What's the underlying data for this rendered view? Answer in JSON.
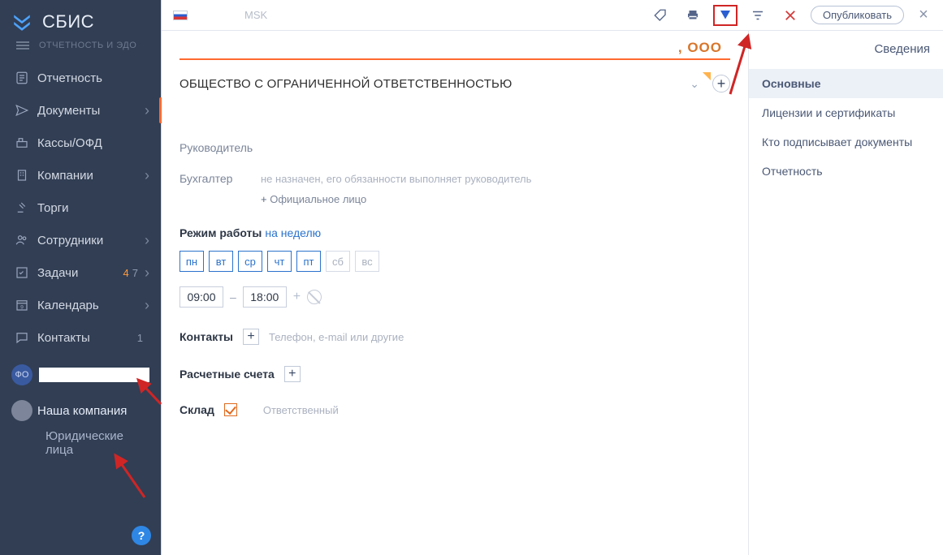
{
  "brand": {
    "title": "СБИС",
    "subtitle": "ОТЧЕТНОСТЬ И ЭДО"
  },
  "sidebar": {
    "items": [
      {
        "label": "Отчетность"
      },
      {
        "label": "Документы"
      },
      {
        "label": "Кассы/ОФД"
      },
      {
        "label": "Компании"
      },
      {
        "label": "Торги"
      },
      {
        "label": "Сотрудники"
      },
      {
        "label": "Задачи",
        "badge_a": "4",
        "badge_b": "7"
      },
      {
        "label": "Календарь"
      },
      {
        "label": "Контакты",
        "badge_b": "1"
      }
    ],
    "avatar_initials": "ФО",
    "company": "Наша компания",
    "sub": "Юридические лица",
    "help": "?"
  },
  "topbar": {
    "tz": "MSK",
    "publish": "Опубликовать"
  },
  "content": {
    "title_suffix": ", ООО",
    "org_type": "ОБЩЕСТВО С ОГРАНИЧЕННОЙ ОТВЕТСТВЕННОСТЬЮ",
    "rows": {
      "director_label": "Руководитель",
      "accountant_label": "Бухгалтер",
      "accountant_note": "не назначен, его обязанности выполняет руководитель",
      "add_official": "Официальное лицо",
      "workmode_label": "Режим работы",
      "workmode_link": "на неделю",
      "days": [
        "пн",
        "вт",
        "ср",
        "чт",
        "пт",
        "сб",
        "вс"
      ],
      "time_from": "09:00",
      "time_to": "18:00",
      "contacts_label": "Контакты",
      "contacts_hint": "Телефон, e-mail или другие",
      "accounts_label": "Расчетные счета",
      "stock_label": "Склад",
      "stock_role": "Ответственный"
    }
  },
  "rightcol": {
    "title": "Сведения",
    "items": [
      "Основные",
      "Лицензии и сертификаты",
      "Кто подписывает документы",
      "Отчетность"
    ]
  }
}
